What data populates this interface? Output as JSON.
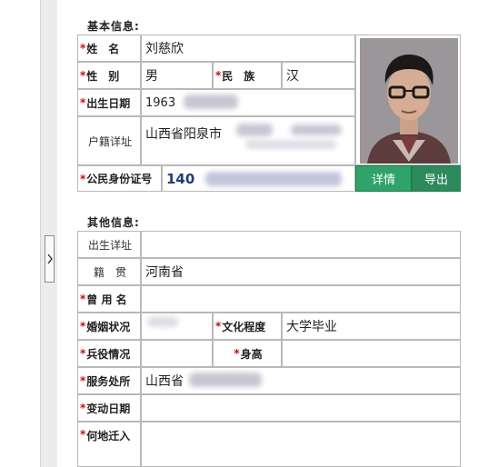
{
  "basic": {
    "title": "基本信息:",
    "name_label": "姓　名",
    "name_value": "刘慈欣",
    "gender_label": "性　别",
    "gender_value": "男",
    "ethnic_label": "民　族",
    "ethnic_value": "汉",
    "birth_label": "出生日期",
    "birth_value": "1963",
    "household_label": "户籍详址",
    "household_value": "山西省阳泉市",
    "idno_label": "公民身份证号",
    "idno_value": "140",
    "detail_button": "详情",
    "export_button": "导出"
  },
  "other": {
    "title": "其他信息:",
    "birthplace_label": "出生详址",
    "native_label": "籍　贯",
    "native_value": "河南省",
    "usedname_label": "曾 用 名",
    "marital_label": "婚姻状况",
    "education_label": "文化程度",
    "education_value": "大学毕业",
    "military_label": "兵役情况",
    "height_label": "身高",
    "workplace_label": "服务处所",
    "workplace_value": "山西省",
    "change_label": "变动日期",
    "movein_label": "何地迁入"
  },
  "colors": {
    "required": "#dd0000",
    "detail_button": "#2ea36a",
    "export_button": "#2d8a5c",
    "border": "#b9b9b9"
  }
}
